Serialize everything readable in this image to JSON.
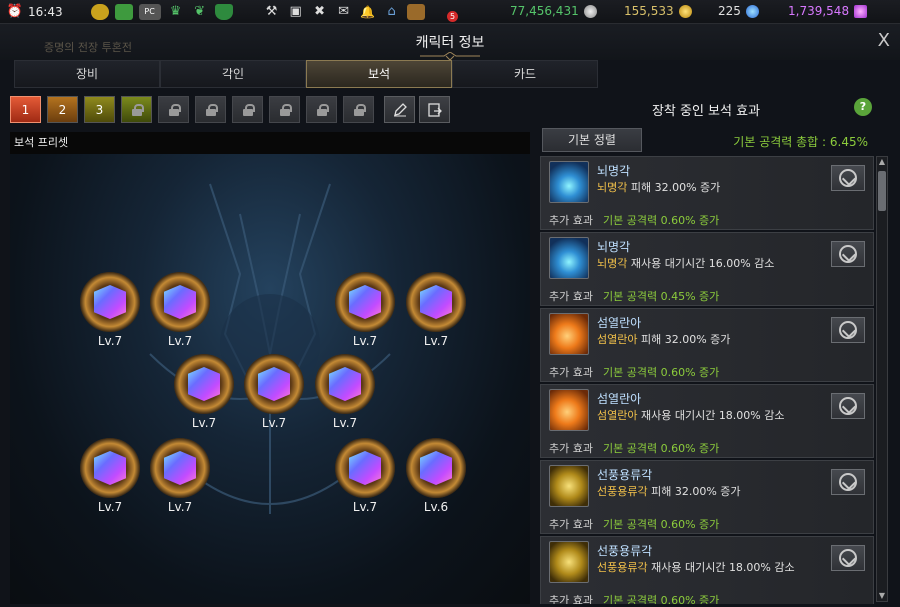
{
  "statusbar": {
    "time": "16:43",
    "pc_label": "PC",
    "mail_badge": "5",
    "silver": "77,456,431",
    "gold": "155,533",
    "crystal": "225",
    "royal_crystal": "1,739,548",
    "colors": {
      "silver": "#55c46a",
      "gold": "#d8c06a",
      "crystal": "#cfcfcf",
      "royal": "#d878ff"
    }
  },
  "window": {
    "title": "캐릭터 정보",
    "background_text": "증명의 전장 투혼전",
    "close_label": "X"
  },
  "tabs": [
    {
      "label": "장비",
      "active": false
    },
    {
      "label": "각인",
      "active": false
    },
    {
      "label": "보석",
      "active": true
    },
    {
      "label": "카드",
      "active": false
    }
  ],
  "presets": {
    "buttons": [
      "1",
      "2",
      "3"
    ],
    "label": "보석 프리셋"
  },
  "gems": [
    {
      "level": "Lv.7"
    },
    {
      "level": "Lv.7"
    },
    {
      "level": "Lv.7"
    },
    {
      "level": "Lv.7"
    },
    {
      "level": "Lv.7"
    },
    {
      "level": "Lv.7"
    },
    {
      "level": "Lv.7"
    },
    {
      "level": "Lv.7"
    },
    {
      "level": "Lv.7"
    },
    {
      "level": "Lv.7"
    },
    {
      "level": "Lv.6"
    }
  ],
  "effects_panel": {
    "title": "장착 중인 보석 효과",
    "help": "?",
    "sort_label": "기본 정렬",
    "total": "기본 공격력 총합 : 6.45%",
    "extra_label": "추가 효과",
    "effects": [
      {
        "name": "뇌명각",
        "skill": "뇌명각",
        "desc": " 피해 32.00% 증가",
        "extra": "기본 공격력 0.60% 증가",
        "icon": "lightning-skill-icon",
        "tone": "blue"
      },
      {
        "name": "뇌명각",
        "skill": "뇌명각",
        "desc": " 재사용 대기시간 16.00% 감소",
        "extra": "기본 공격력 0.45% 증가",
        "icon": "lightning-skill-icon",
        "tone": "blue"
      },
      {
        "name": "섬열란아",
        "skill": "섬열란아",
        "desc": " 피해 32.00% 증가",
        "extra": "기본 공격력 0.60% 증가",
        "icon": "flame-skill-icon",
        "tone": "orange"
      },
      {
        "name": "섬열란아",
        "skill": "섬열란아",
        "desc": " 재사용 대기시간 18.00% 감소",
        "extra": "기본 공격력 0.60% 증가",
        "icon": "flame-skill-icon",
        "tone": "orange"
      },
      {
        "name": "선풍용류각",
        "skill": "선풍용류각",
        "desc": " 피해 32.00% 증가",
        "extra": "기본 공격력 0.60% 증가",
        "icon": "whirlwind-skill-icon",
        "tone": "gold"
      },
      {
        "name": "선풍용류각",
        "skill": "선풍용류각",
        "desc": " 재사용 대기시간 18.00% 감소",
        "extra": "기본 공격력 0.60% 증가",
        "icon": "whirlwind-skill-icon",
        "tone": "gold"
      }
    ]
  }
}
